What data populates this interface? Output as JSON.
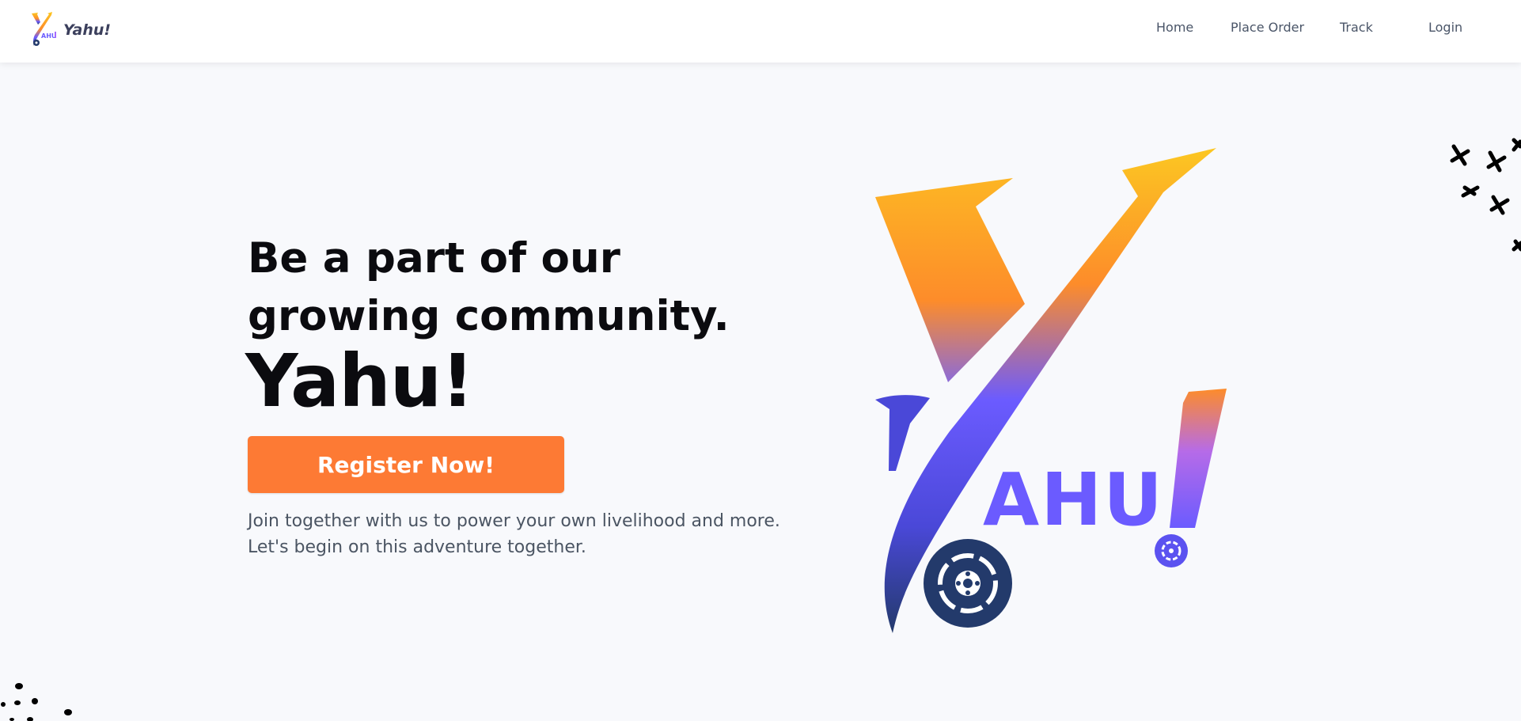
{
  "navbar": {
    "brand": {
      "name": "Yahu!",
      "logo_icon": "yahu-logo-icon"
    },
    "links": [
      {
        "label": "Home"
      },
      {
        "label": "Place Order"
      },
      {
        "label": "Track"
      },
      {
        "label": "Login"
      }
    ]
  },
  "hero": {
    "title": "Be a part of our growing community.",
    "brand": "Yahu!",
    "cta_label": "Register Now!",
    "description_line1": "Join together with us to power your own livelihood and more.",
    "description_line2": "Let's begin on this adventure together.",
    "logo_wordmark": "AHU"
  },
  "colors": {
    "accent": "#fd7a34",
    "gradient_top": "#fcc722",
    "gradient_mid": "#6b5bff",
    "gradient_bottom": "#233a6b",
    "text_dark": "#0b0b0f",
    "text_muted": "#4b5563"
  }
}
